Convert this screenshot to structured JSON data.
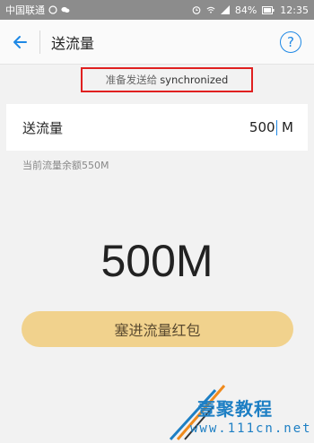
{
  "status_bar": {
    "carrier": "中国联通",
    "battery": "84%",
    "time": "12:35",
    "icons": [
      "sim-icon",
      "wechat-icon",
      "alarm-icon",
      "wifi-icon",
      "signal-icon",
      "battery-icon"
    ]
  },
  "header": {
    "title": "送流量",
    "back_icon": "back-arrow-icon",
    "help_label": "?"
  },
  "recipient": {
    "prefix": "准备发送给",
    "name": "synchronized"
  },
  "input": {
    "label": "送流量",
    "value": "500",
    "unit": "M"
  },
  "balance": "当前流量余额550M",
  "amount_display": "500M",
  "send_button": "塞进流量红包",
  "watermark": {
    "text": "壹聚教程",
    "url": "www.111cn.net"
  },
  "colors": {
    "accent": "#1e88e5",
    "button": "#f1d28d",
    "highlight_border": "#e02020"
  }
}
